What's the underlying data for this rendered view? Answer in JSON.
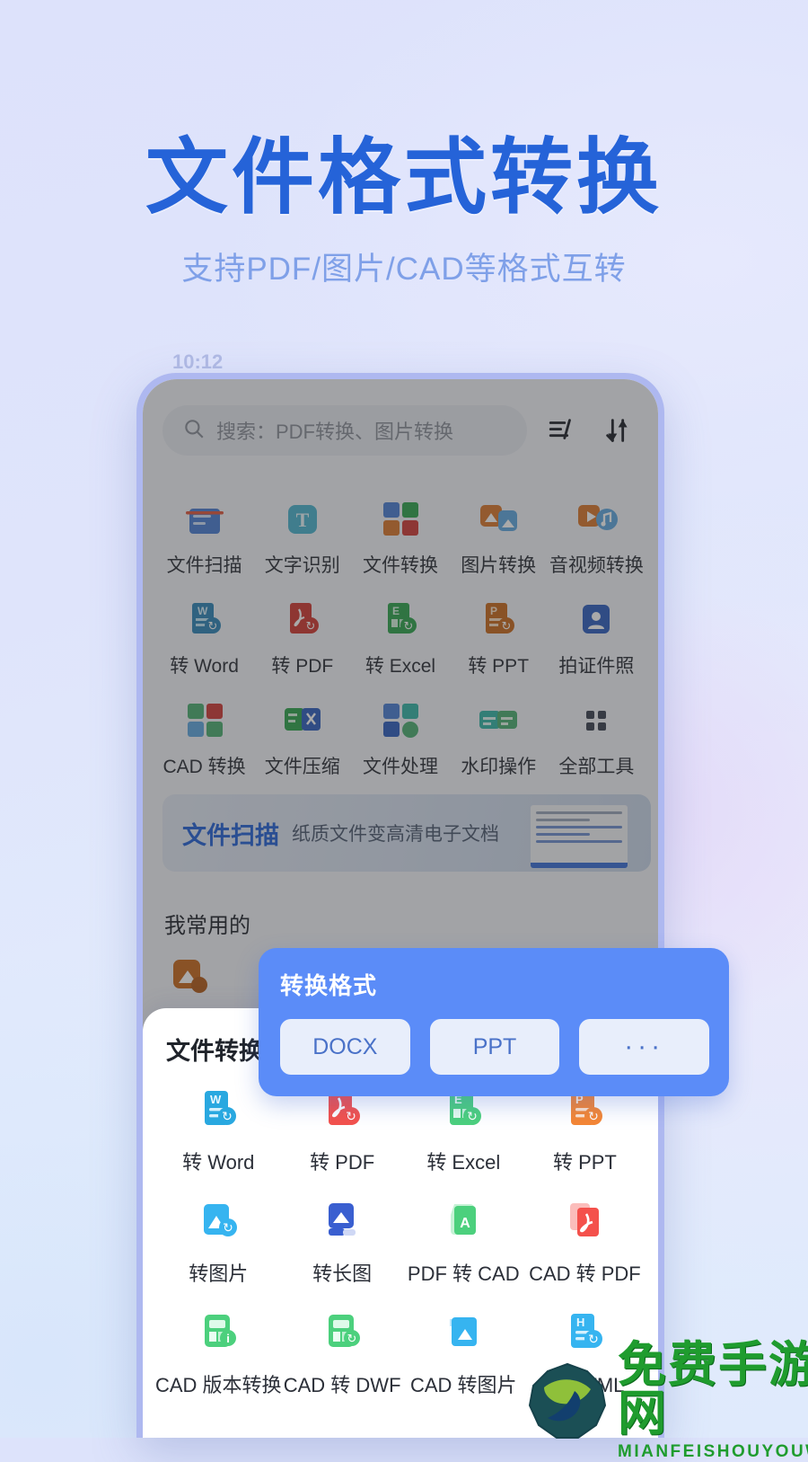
{
  "hero": {
    "title": "文件格式转换",
    "subtitle": "支持PDF/图片/CAD等格式互转",
    "title_color": "#2563d8",
    "subtitle_color": "#7fa0e8"
  },
  "phone": {
    "status_time": "10:12",
    "search": {
      "placeholder": "搜索：PDF转换、图片转换",
      "icon": "search-icon"
    },
    "header_icons": [
      {
        "name": "edit-list-icon",
        "label": "编辑"
      },
      {
        "name": "sort-icon",
        "label": "排序"
      }
    ],
    "grid_rows": [
      [
        {
          "label": "文件扫描",
          "icon": "scan-doc-icon",
          "color": "#4a7fd4"
        },
        {
          "label": "文字识别",
          "icon": "ocr-text-icon",
          "color": "#4bb3cf"
        },
        {
          "label": "文件转换",
          "icon": "file-convert-icon",
          "color": "#4a7fd4"
        },
        {
          "label": "图片转换",
          "icon": "image-convert-icon",
          "color": "#d9772e"
        },
        {
          "label": "音视频转换",
          "icon": "media-convert-icon",
          "color": "#d9772e"
        }
      ],
      [
        {
          "label": "转 Word",
          "icon": "to-word-icon",
          "color": "#2f86b8"
        },
        {
          "label": "转 PDF",
          "icon": "to-pdf-icon",
          "color": "#d13a32"
        },
        {
          "label": "转 Excel",
          "icon": "to-excel-icon",
          "color": "#2fa44f"
        },
        {
          "label": "转 PPT",
          "icon": "to-ppt-icon",
          "color": "#c96a1e"
        },
        {
          "label": "拍证件照",
          "icon": "id-photo-icon",
          "color": "#2f5fc0"
        }
      ],
      [
        {
          "label": "CAD 转换",
          "icon": "cad-convert-icon",
          "color": "#4caf72"
        },
        {
          "label": "文件压缩",
          "icon": "file-compress-icon",
          "color": "#2fa44f"
        },
        {
          "label": "文件处理",
          "icon": "file-process-icon",
          "color": "#4a7fd4"
        },
        {
          "label": "水印操作",
          "icon": "watermark-icon",
          "color": "#34b6a8"
        },
        {
          "label": "全部工具",
          "icon": "all-tools-icon",
          "color": "#3b4252"
        }
      ]
    ],
    "banner": {
      "title": "文件扫描",
      "subtitle": "纸质文件变高清电子文档"
    },
    "section_title": "我常用的",
    "common_items": [
      {
        "label": "图片转换",
        "icon": "image-convert-icon",
        "color": "#c96a1e"
      }
    ]
  },
  "popup": {
    "title": "转换格式",
    "options": [
      "DOCX",
      "PPT",
      "···"
    ],
    "bg_color": "#5b8cf8",
    "chip_color": "#e8eefb",
    "chip_text_color": "#4a72c8"
  },
  "sheet": {
    "title": "文件转换",
    "items": [
      {
        "label": "转 Word",
        "icon": "to-word-icon",
        "color": "#29a8e0"
      },
      {
        "label": "转 PDF",
        "icon": "to-pdf-icon",
        "color": "#f4514c"
      },
      {
        "label": "转 Excel",
        "icon": "to-excel-icon",
        "color": "#4cd07d"
      },
      {
        "label": "转 PPT",
        "icon": "to-ppt-icon",
        "color": "#f58634"
      },
      {
        "label": "转图片",
        "icon": "to-image-icon",
        "color": "#36b4f0"
      },
      {
        "label": "转长图",
        "icon": "to-longimage-icon",
        "color": "#3a5fd0"
      },
      {
        "label": "PDF 转 CAD",
        "icon": "pdf-to-cad-icon",
        "color": "#4cd07d"
      },
      {
        "label": "CAD 转 PDF",
        "icon": "cad-to-pdf-icon",
        "color": "#f4514c"
      },
      {
        "label": "CAD 版本转换",
        "icon": "cad-version-icon",
        "color": "#4cd07d"
      },
      {
        "label": "CAD 转 DWF",
        "icon": "cad-to-dwf-icon",
        "color": "#4cd07d"
      },
      {
        "label": "CAD 转图片",
        "icon": "cad-to-image-icon",
        "color": "#36b4f0"
      },
      {
        "label": "转 HTML",
        "icon": "to-html-icon",
        "color": "#36b4f0"
      }
    ]
  },
  "watermark": {
    "cn": "免费手游网",
    "en": "MIANFEISHOUYOUWANG",
    "color": "#1f9c2e"
  }
}
